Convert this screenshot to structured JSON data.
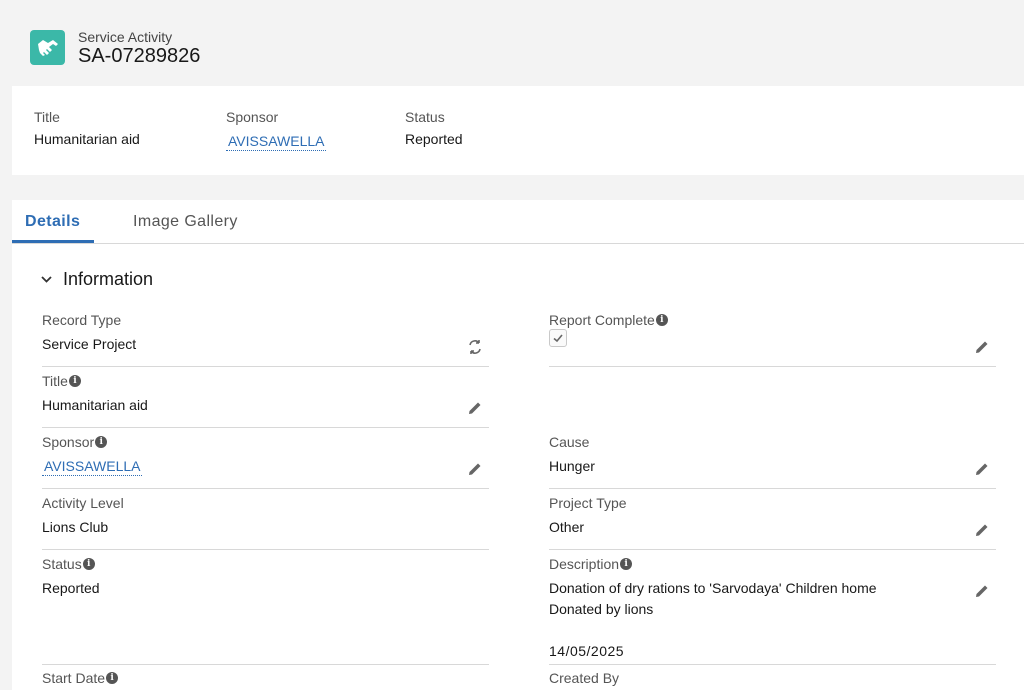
{
  "header": {
    "object_label": "Service Activity",
    "record_name": "SA-07289826",
    "icon": "handshake-icon",
    "icon_color": "#3bb8a8"
  },
  "highlights": {
    "title_label": "Title",
    "title_value": "Humanitarian aid",
    "sponsor_label": "Sponsor",
    "sponsor_value": "AVISSAWELLA",
    "status_label": "Status",
    "status_value": "Reported"
  },
  "tabs": [
    {
      "label": "Details",
      "active": true
    },
    {
      "label": "Image Gallery",
      "active": false
    }
  ],
  "section": {
    "title": "Information"
  },
  "fields": {
    "record_type": {
      "label": "Record Type",
      "value": "Service Project"
    },
    "report_complete": {
      "label": "Report Complete",
      "checked": true
    },
    "title": {
      "label": "Title",
      "value": "Humanitarian aid"
    },
    "sponsor": {
      "label": "Sponsor",
      "value": "AVISSAWELLA"
    },
    "cause": {
      "label": "Cause",
      "value": "Hunger"
    },
    "activity_level": {
      "label": "Activity Level",
      "value": "Lions Club"
    },
    "project_type": {
      "label": "Project Type",
      "value": "Other"
    },
    "status": {
      "label": "Status",
      "value": "Reported"
    },
    "description": {
      "label": "Description",
      "line1": "Donation of dry rations to 'Sarvodaya' Children home",
      "line2": "Donated by lions",
      "line3": "14/05/2025"
    },
    "start_date": {
      "label": "Start Date"
    },
    "created_by": {
      "label": "Created By"
    }
  },
  "colors": {
    "accent": "#2e6db4",
    "background": "#f3f3f3"
  }
}
